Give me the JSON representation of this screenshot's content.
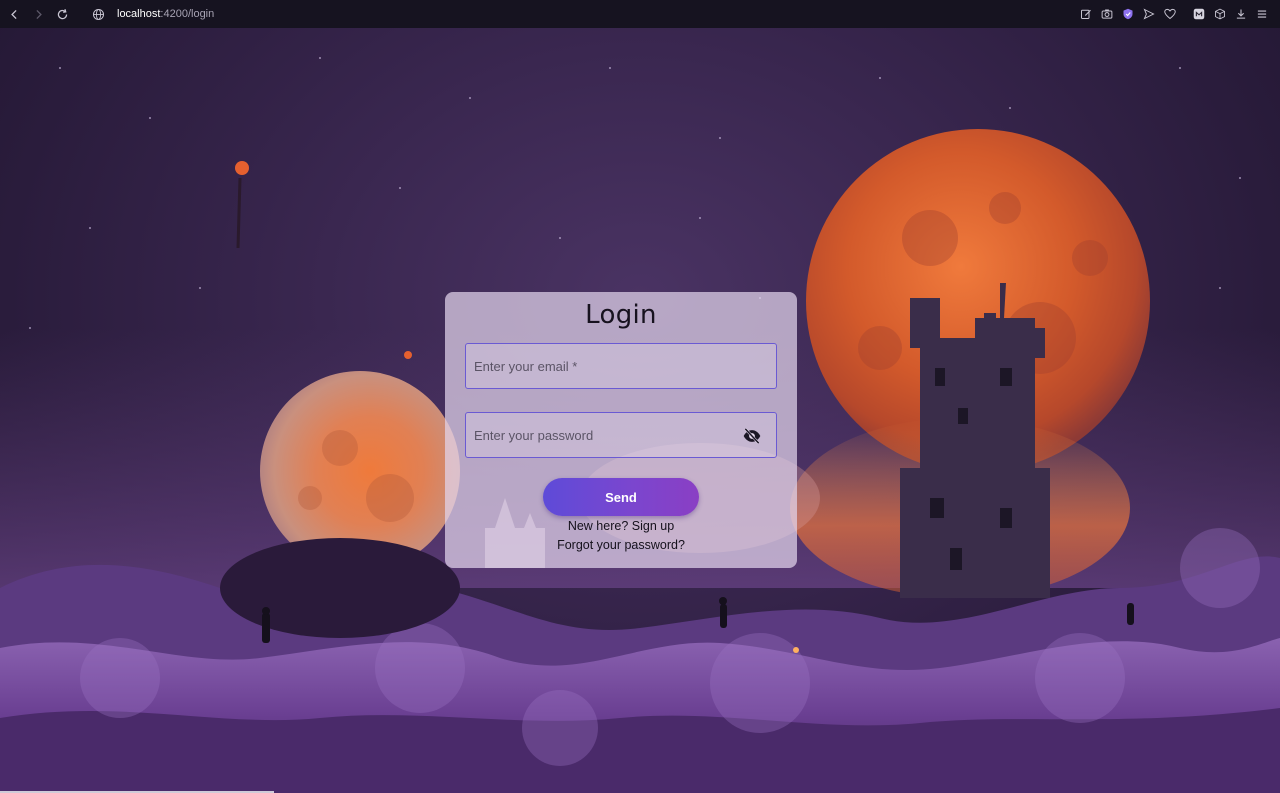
{
  "browser": {
    "url_host": "localhost",
    "url_path": ":4200/login",
    "nav_icons": [
      "back-arrow-icon",
      "forward-arrow-icon",
      "reload-icon"
    ],
    "toolbar_icons": [
      "edit-icon",
      "camera-icon",
      "shield-icon",
      "send-icon",
      "heart-icon",
      "extension-icon",
      "cube-icon",
      "download-icon",
      "menu-icon"
    ]
  },
  "login": {
    "title": "Login",
    "email_placeholder": "Enter your email *",
    "password_placeholder": "Enter your password",
    "password_toggle_icon": "eye-off-icon",
    "send_label": "Send",
    "signup_label": "New here? Sign up",
    "forgot_label": "Forgot your password?"
  },
  "colors": {
    "field_border": "#6a5ad3",
    "button_gradient_start": "#5e4bd8",
    "button_gradient_end": "#8a3fc4",
    "card_background": "#e2d4ec"
  }
}
